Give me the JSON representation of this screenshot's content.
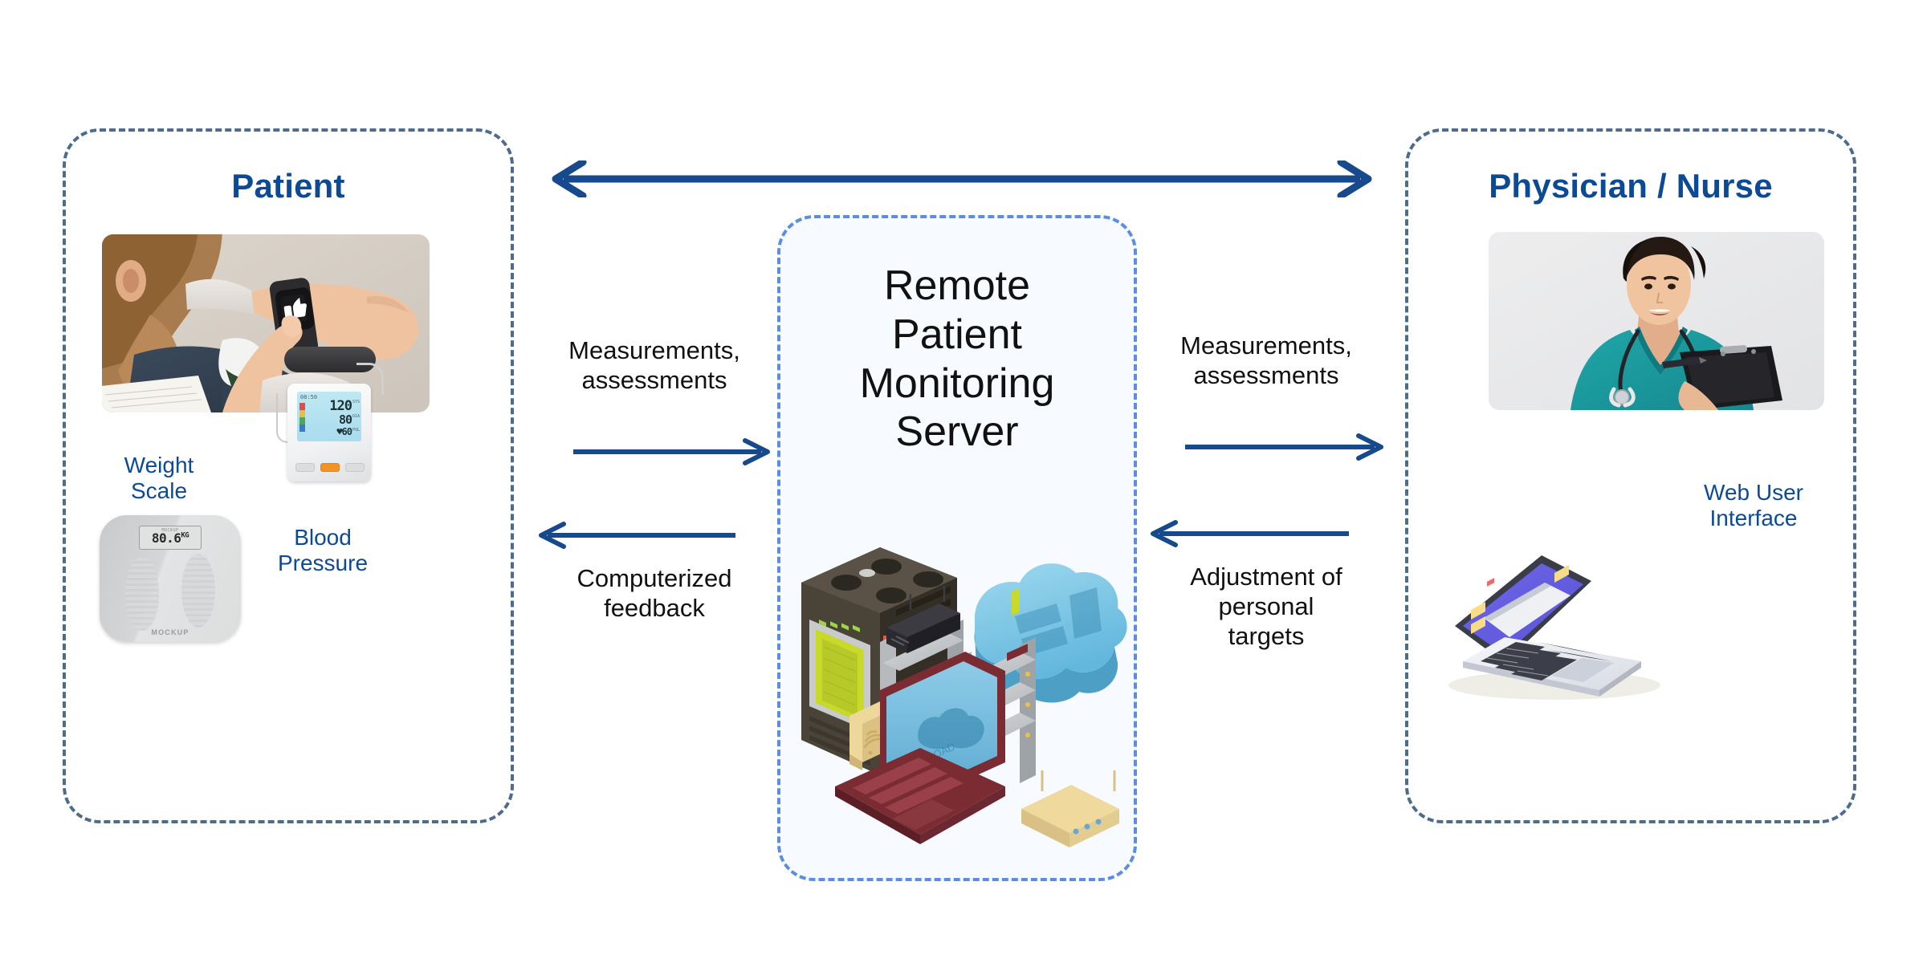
{
  "panels": {
    "left": {
      "title": "Patient",
      "photo_alt": "patient-checking-smartwatch",
      "devices": [
        {
          "label_line1": "Weight",
          "label_line2": "Scale",
          "icon": "weight-scale-icon",
          "display_value": "80.6",
          "display_unit": "KG",
          "brand": "MOCKUP",
          "brand_small": "MOCKUP"
        },
        {
          "label_line1": "Blood",
          "label_line2": "Pressure",
          "icon": "blood-pressure-monitor-icon",
          "time": "08:50",
          "systolic": "120",
          "diastolic": "80",
          "pulse": "60",
          "unit_sys": "SYS",
          "unit_dia": "DIA",
          "unit_pul": "PUL"
        }
      ]
    },
    "center": {
      "title_lines": [
        "Remote",
        "Patient",
        "Monitoring",
        "Server"
      ],
      "illustration": "isometric-server-cloud-network-icon",
      "laptop_screen_text": "UPLOAD"
    },
    "right": {
      "title": "Physician / Nurse",
      "photo_alt": "smiling-nurse-with-clipboard",
      "device": {
        "label_line1": "Web User",
        "label_line2": "Interface",
        "icon": "laptop-icon"
      }
    }
  },
  "flows": {
    "top_bidirectional": {
      "icon": "double-headed-arrow-icon",
      "label": ""
    },
    "left_out": {
      "label_line1": "Measurements,",
      "label_line2": "assessments",
      "direction": "right"
    },
    "left_in": {
      "label_line1": "Computerized",
      "label_line2": "feedback",
      "direction": "left"
    },
    "right_out": {
      "label_line1": "Measurements,",
      "label_line2": "assessments",
      "direction": "right"
    },
    "right_in": {
      "label_line1": "Adjustment of",
      "label_line2": "personal",
      "label_line3": "targets",
      "direction": "left"
    }
  },
  "colors": {
    "panel_border": "#4d6c8d",
    "center_border": "#5b8de0",
    "center_fill": "#f7fbff",
    "heading": "#0d4a96",
    "arrow": "#1a4f8a",
    "body_text": "#111111"
  }
}
